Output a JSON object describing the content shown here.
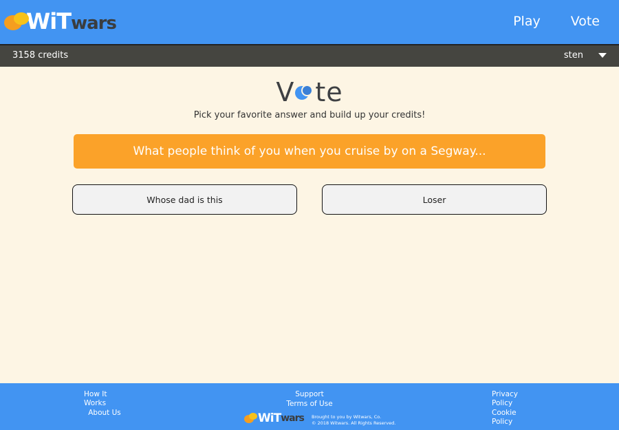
{
  "header": {
    "logo": {
      "wit": "WiT",
      "wars": "wars"
    },
    "nav": [
      {
        "label": "Play"
      },
      {
        "label": "Vote"
      }
    ]
  },
  "credit_bar": {
    "credits": "3158 credits",
    "username": "sten"
  },
  "main": {
    "title": {
      "v": "V",
      "rest": "te"
    },
    "subtitle": "Pick your favorite answer and build up your credits!",
    "prompt": "What people think of you when you cruise by on a Segway...",
    "answers": [
      {
        "label": "Whose dad is this"
      },
      {
        "label": "Loser"
      }
    ]
  },
  "footer": {
    "col1": [
      {
        "label": "How It Works"
      },
      {
        "label": "About Us"
      }
    ],
    "col2": [
      {
        "label": "Support"
      },
      {
        "label": "Terms of Use"
      }
    ],
    "col3": [
      {
        "label": "Privacy Policy"
      },
      {
        "label": "Cookie Policy"
      }
    ],
    "logo": {
      "wit": "WiT",
      "wars": "wars"
    },
    "note": [
      "Brought to you by Witwars, Co.",
      "© 2018 Witwars. All Rights Reserved."
    ]
  },
  "colors": {
    "header_blue": "#4294f2",
    "credit_bar": "#454540",
    "background": "#fdf5e4",
    "prompt_orange": "#fba229",
    "logo_orange": "#f59e1f",
    "logo_yellow": "#f7c21a"
  }
}
